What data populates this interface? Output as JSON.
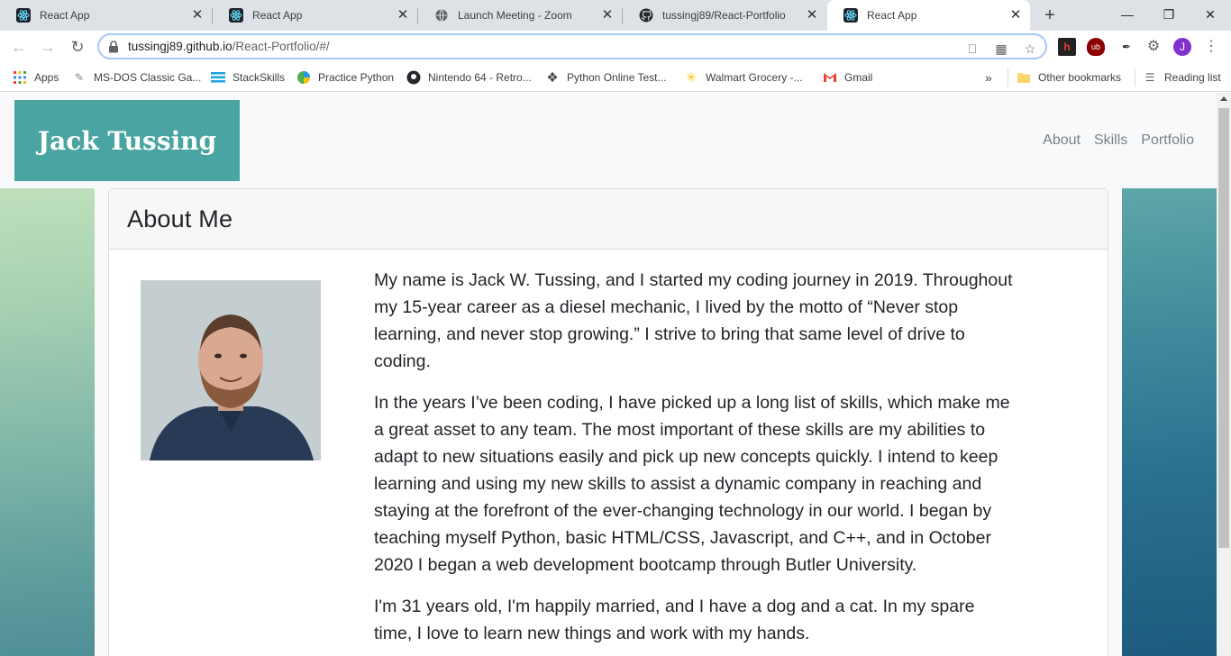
{
  "browser": {
    "tabs": [
      {
        "title": "React App",
        "icon": "react-icon",
        "active": false
      },
      {
        "title": "React App",
        "icon": "react-icon",
        "active": false
      },
      {
        "title": "Launch Meeting - Zoom",
        "icon": "globe-icon",
        "active": false
      },
      {
        "title": "tussingj89/React-Portfolio",
        "icon": "github-icon",
        "active": false
      },
      {
        "title": "React App",
        "icon": "react-icon",
        "active": true
      }
    ],
    "url_host": "tussingj89.github.io",
    "url_path": "/React-Portfolio/#/",
    "profile_initial": "J",
    "bookmarks": [
      {
        "label": "Apps",
        "icon": "apps-grid-icon"
      },
      {
        "label": "MS-DOS Classic Ga...",
        "icon": "msdos-icon"
      },
      {
        "label": "StackSkills",
        "icon": "stack-icon"
      },
      {
        "label": "Practice Python",
        "icon": "python-icon"
      },
      {
        "label": "Nintendo 64 - Retro...",
        "icon": "github-icon"
      },
      {
        "label": "Python Online Test...",
        "icon": "diamond-icon"
      },
      {
        "label": "Walmart Grocery -...",
        "icon": "walmart-icon"
      },
      {
        "label": "Gmail",
        "icon": "gmail-icon"
      }
    ],
    "overflow_chevron": "»",
    "other_bookmarks": "Other bookmarks",
    "reading_list": "Reading list"
  },
  "site": {
    "brand": "Jack Tussing",
    "nav": [
      {
        "label": "About"
      },
      {
        "label": "Skills"
      },
      {
        "label": "Portfolio"
      }
    ]
  },
  "about": {
    "heading": "About Me",
    "paragraphs": [
      "My name is Jack W. Tussing, and I started my coding journey in 2019. Throughout my 15-year career as a diesel mechanic, I lived by the motto of “Never stop learning, and never stop growing.” I strive to bring that same level of drive to coding.",
      "In the years I’ve been coding, I have picked up a long list of skills, which make me a great asset to any team. The most important of these skills are my abilities to adapt to new situations easily and pick up new concepts quickly. I intend to keep learning and using my new skills to assist a dynamic company in reaching and staying at the forefront of the ever-changing technology in our world. I began by teaching myself Python, basic HTML/CSS, Javascript, and C++, and in October 2020 I began a web development bootcamp through Butler University.",
      "I'm 31 years old, I'm happily married, and I have a dog and a cat. In my spare time, I love to learn new things and work with my hands."
    ]
  },
  "colors": {
    "brand_bg": "#4aa4a1",
    "nav_link": "#7b7f84",
    "chrome_bg": "#dee1e6"
  }
}
